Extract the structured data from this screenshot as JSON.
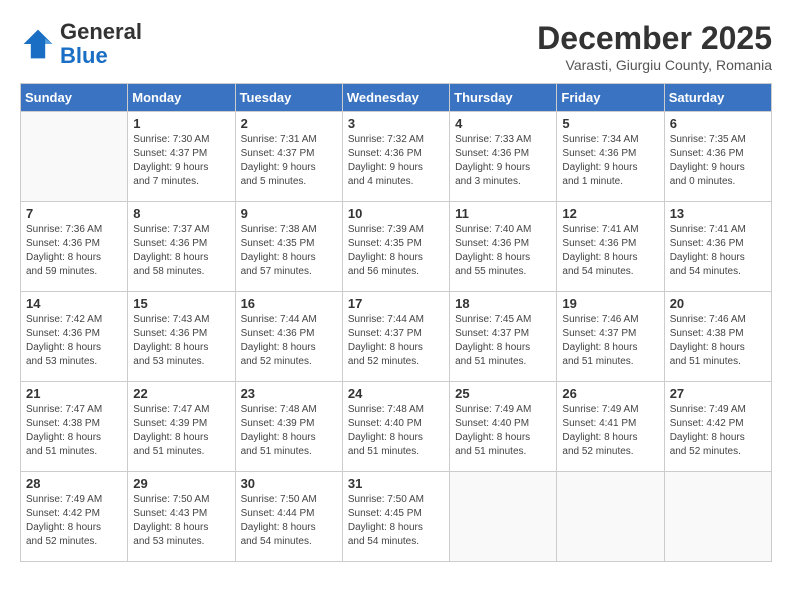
{
  "logo": {
    "general": "General",
    "blue": "Blue"
  },
  "title": "December 2025",
  "location": "Varasti, Giurgiu County, Romania",
  "weekdays": [
    "Sunday",
    "Monday",
    "Tuesday",
    "Wednesday",
    "Thursday",
    "Friday",
    "Saturday"
  ],
  "weeks": [
    [
      {
        "day": "",
        "info": ""
      },
      {
        "day": "1",
        "info": "Sunrise: 7:30 AM\nSunset: 4:37 PM\nDaylight: 9 hours\nand 7 minutes."
      },
      {
        "day": "2",
        "info": "Sunrise: 7:31 AM\nSunset: 4:37 PM\nDaylight: 9 hours\nand 5 minutes."
      },
      {
        "day": "3",
        "info": "Sunrise: 7:32 AM\nSunset: 4:36 PM\nDaylight: 9 hours\nand 4 minutes."
      },
      {
        "day": "4",
        "info": "Sunrise: 7:33 AM\nSunset: 4:36 PM\nDaylight: 9 hours\nand 3 minutes."
      },
      {
        "day": "5",
        "info": "Sunrise: 7:34 AM\nSunset: 4:36 PM\nDaylight: 9 hours\nand 1 minute."
      },
      {
        "day": "6",
        "info": "Sunrise: 7:35 AM\nSunset: 4:36 PM\nDaylight: 9 hours\nand 0 minutes."
      }
    ],
    [
      {
        "day": "7",
        "info": "Sunrise: 7:36 AM\nSunset: 4:36 PM\nDaylight: 8 hours\nand 59 minutes."
      },
      {
        "day": "8",
        "info": "Sunrise: 7:37 AM\nSunset: 4:36 PM\nDaylight: 8 hours\nand 58 minutes."
      },
      {
        "day": "9",
        "info": "Sunrise: 7:38 AM\nSunset: 4:35 PM\nDaylight: 8 hours\nand 57 minutes."
      },
      {
        "day": "10",
        "info": "Sunrise: 7:39 AM\nSunset: 4:35 PM\nDaylight: 8 hours\nand 56 minutes."
      },
      {
        "day": "11",
        "info": "Sunrise: 7:40 AM\nSunset: 4:36 PM\nDaylight: 8 hours\nand 55 minutes."
      },
      {
        "day": "12",
        "info": "Sunrise: 7:41 AM\nSunset: 4:36 PM\nDaylight: 8 hours\nand 54 minutes."
      },
      {
        "day": "13",
        "info": "Sunrise: 7:41 AM\nSunset: 4:36 PM\nDaylight: 8 hours\nand 54 minutes."
      }
    ],
    [
      {
        "day": "14",
        "info": "Sunrise: 7:42 AM\nSunset: 4:36 PM\nDaylight: 8 hours\nand 53 minutes."
      },
      {
        "day": "15",
        "info": "Sunrise: 7:43 AM\nSunset: 4:36 PM\nDaylight: 8 hours\nand 53 minutes."
      },
      {
        "day": "16",
        "info": "Sunrise: 7:44 AM\nSunset: 4:36 PM\nDaylight: 8 hours\nand 52 minutes."
      },
      {
        "day": "17",
        "info": "Sunrise: 7:44 AM\nSunset: 4:37 PM\nDaylight: 8 hours\nand 52 minutes."
      },
      {
        "day": "18",
        "info": "Sunrise: 7:45 AM\nSunset: 4:37 PM\nDaylight: 8 hours\nand 51 minutes."
      },
      {
        "day": "19",
        "info": "Sunrise: 7:46 AM\nSunset: 4:37 PM\nDaylight: 8 hours\nand 51 minutes."
      },
      {
        "day": "20",
        "info": "Sunrise: 7:46 AM\nSunset: 4:38 PM\nDaylight: 8 hours\nand 51 minutes."
      }
    ],
    [
      {
        "day": "21",
        "info": "Sunrise: 7:47 AM\nSunset: 4:38 PM\nDaylight: 8 hours\nand 51 minutes."
      },
      {
        "day": "22",
        "info": "Sunrise: 7:47 AM\nSunset: 4:39 PM\nDaylight: 8 hours\nand 51 minutes."
      },
      {
        "day": "23",
        "info": "Sunrise: 7:48 AM\nSunset: 4:39 PM\nDaylight: 8 hours\nand 51 minutes."
      },
      {
        "day": "24",
        "info": "Sunrise: 7:48 AM\nSunset: 4:40 PM\nDaylight: 8 hours\nand 51 minutes."
      },
      {
        "day": "25",
        "info": "Sunrise: 7:49 AM\nSunset: 4:40 PM\nDaylight: 8 hours\nand 51 minutes."
      },
      {
        "day": "26",
        "info": "Sunrise: 7:49 AM\nSunset: 4:41 PM\nDaylight: 8 hours\nand 52 minutes."
      },
      {
        "day": "27",
        "info": "Sunrise: 7:49 AM\nSunset: 4:42 PM\nDaylight: 8 hours\nand 52 minutes."
      }
    ],
    [
      {
        "day": "28",
        "info": "Sunrise: 7:49 AM\nSunset: 4:42 PM\nDaylight: 8 hours\nand 52 minutes."
      },
      {
        "day": "29",
        "info": "Sunrise: 7:50 AM\nSunset: 4:43 PM\nDaylight: 8 hours\nand 53 minutes."
      },
      {
        "day": "30",
        "info": "Sunrise: 7:50 AM\nSunset: 4:44 PM\nDaylight: 8 hours\nand 54 minutes."
      },
      {
        "day": "31",
        "info": "Sunrise: 7:50 AM\nSunset: 4:45 PM\nDaylight: 8 hours\nand 54 minutes."
      },
      {
        "day": "",
        "info": ""
      },
      {
        "day": "",
        "info": ""
      },
      {
        "day": "",
        "info": ""
      }
    ]
  ]
}
